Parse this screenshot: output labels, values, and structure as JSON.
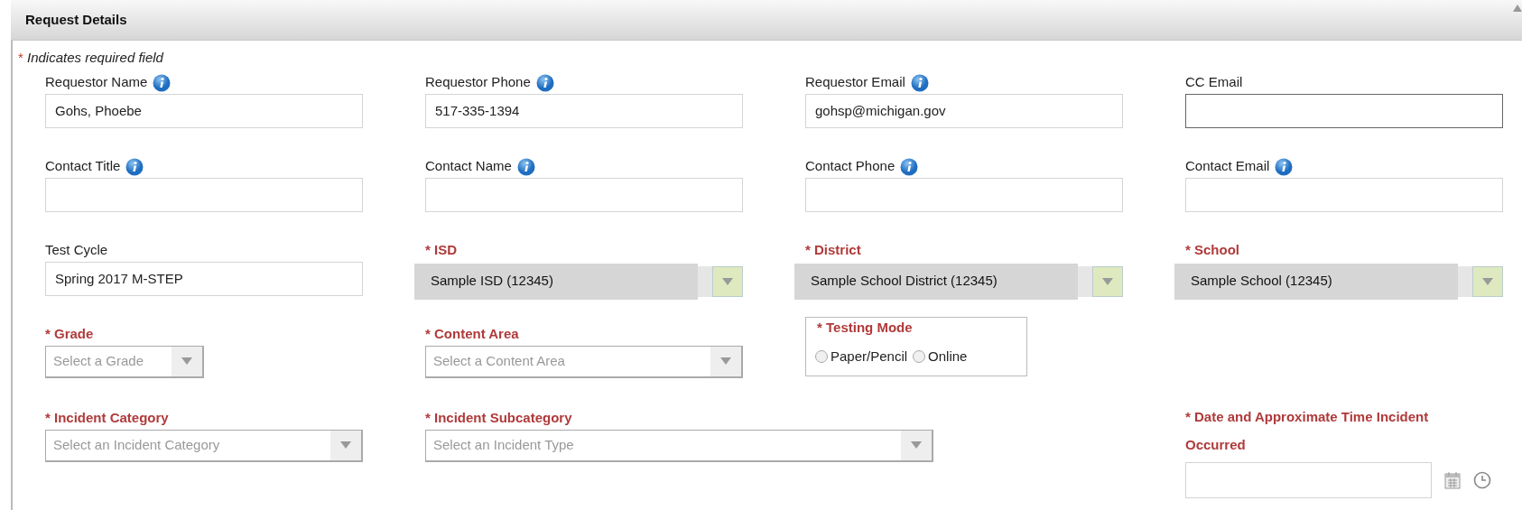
{
  "panel": {
    "title": "Request Details"
  },
  "required_note": {
    "mark": "*",
    "text": "Indicates required field"
  },
  "rows": [
    [
      {
        "kind": "text",
        "label": "Requestor Name",
        "required": false,
        "info": true,
        "value": "Gohs, Phoebe",
        "focused": false
      },
      {
        "kind": "text",
        "label": "Requestor Phone",
        "required": false,
        "info": true,
        "value": "517-335-1394",
        "focused": false
      },
      {
        "kind": "text",
        "label": "Requestor Email",
        "required": false,
        "info": true,
        "value": "gohsp@michigan.gov",
        "focused": false
      },
      {
        "kind": "text",
        "label": "CC Email",
        "required": false,
        "info": false,
        "focused": true
      }
    ],
    [
      {
        "kind": "text",
        "label": "Contact Title",
        "required": false,
        "info": true,
        "focused": false
      },
      {
        "kind": "text",
        "label": "Contact Name",
        "required": false,
        "info": true,
        "focused": false
      },
      {
        "kind": "text",
        "label": "Contact Phone",
        "required": false,
        "info": true,
        "focused": false
      },
      {
        "kind": "text",
        "label": "Contact Email",
        "required": false,
        "info": true,
        "focused": false
      }
    ],
    [
      {
        "kind": "text",
        "label": "Test Cycle",
        "required": false,
        "info": false,
        "value": "Spring 2017 M-STEP",
        "focused": false
      },
      {
        "kind": "select",
        "label": "ISD",
        "required": true,
        "mark": "*",
        "info": false,
        "value": "Sample ISD (12345)"
      },
      {
        "kind": "select",
        "label": "District",
        "required": true,
        "mark": "*",
        "info": false,
        "value": "Sample School District (12345)"
      },
      {
        "kind": "select",
        "label": "School",
        "required": true,
        "mark": "*",
        "info": false,
        "value": "Sample School (12345)"
      }
    ],
    [
      {
        "kind": "select",
        "label": "Grade",
        "required": true,
        "mark": "*",
        "info": false,
        "placeholder": "Select a Grade",
        "narrow": true
      },
      {
        "kind": "select",
        "label": "Content Area",
        "required": true,
        "mark": "*",
        "info": false,
        "placeholder": "Select a Content Area"
      },
      {
        "kind": "radio-group",
        "label": "Testing Mode",
        "required": true,
        "mark": "*",
        "options": [
          {
            "label": "Paper/Pencil",
            "selected": false
          },
          {
            "label": "Online",
            "selected": false
          }
        ]
      }
    ],
    [
      {
        "kind": "select",
        "label": "Incident Category",
        "required": true,
        "mark": "*",
        "info": false,
        "placeholder": "Select an Incident Category"
      },
      {
        "kind": "select",
        "label": "Incident Subcategory",
        "required": true,
        "mark": "*",
        "info": false,
        "placeholder": "Select an Incident Type",
        "wide": true
      },
      {
        "kind": "datetime",
        "label": "Date and Approximate Time Incident Occurred",
        "required": true,
        "mark": "*"
      }
    ]
  ]
}
